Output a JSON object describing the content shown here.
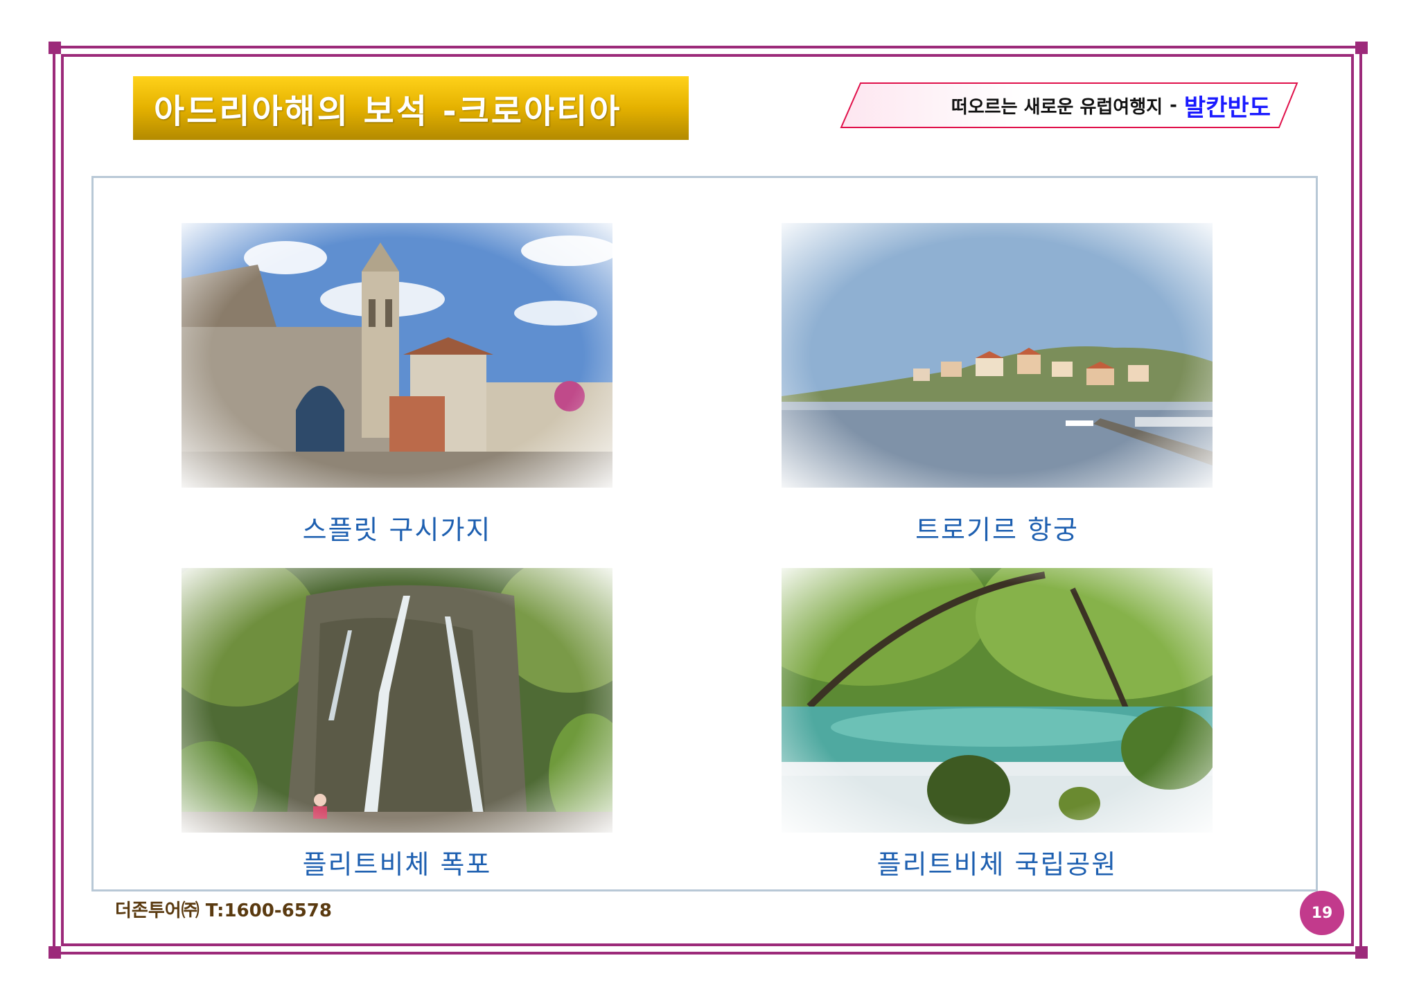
{
  "slide": {
    "title": "아드리아해의 보석 -크로아티아",
    "subtitle_text": "떠오르는 새로운 유럽여행지",
    "subtitle_separator": "-",
    "subtitle_accent": "발칸반도"
  },
  "photos": [
    {
      "caption": "스플릿 구시가지"
    },
    {
      "caption": "트로기르 항궁"
    },
    {
      "caption": "플리트비체 폭포"
    },
    {
      "caption": "플리트비체 국립공원"
    }
  ],
  "footer": {
    "company": "더존투어㈜ T:1600-6578",
    "page_number": "19"
  },
  "colors": {
    "frame": "#9c2a7a",
    "title_gold": "#e4b100",
    "caption_blue": "#1d5fb0",
    "accent_blue": "#1a1aff",
    "page_badge": "#c23a8c"
  }
}
